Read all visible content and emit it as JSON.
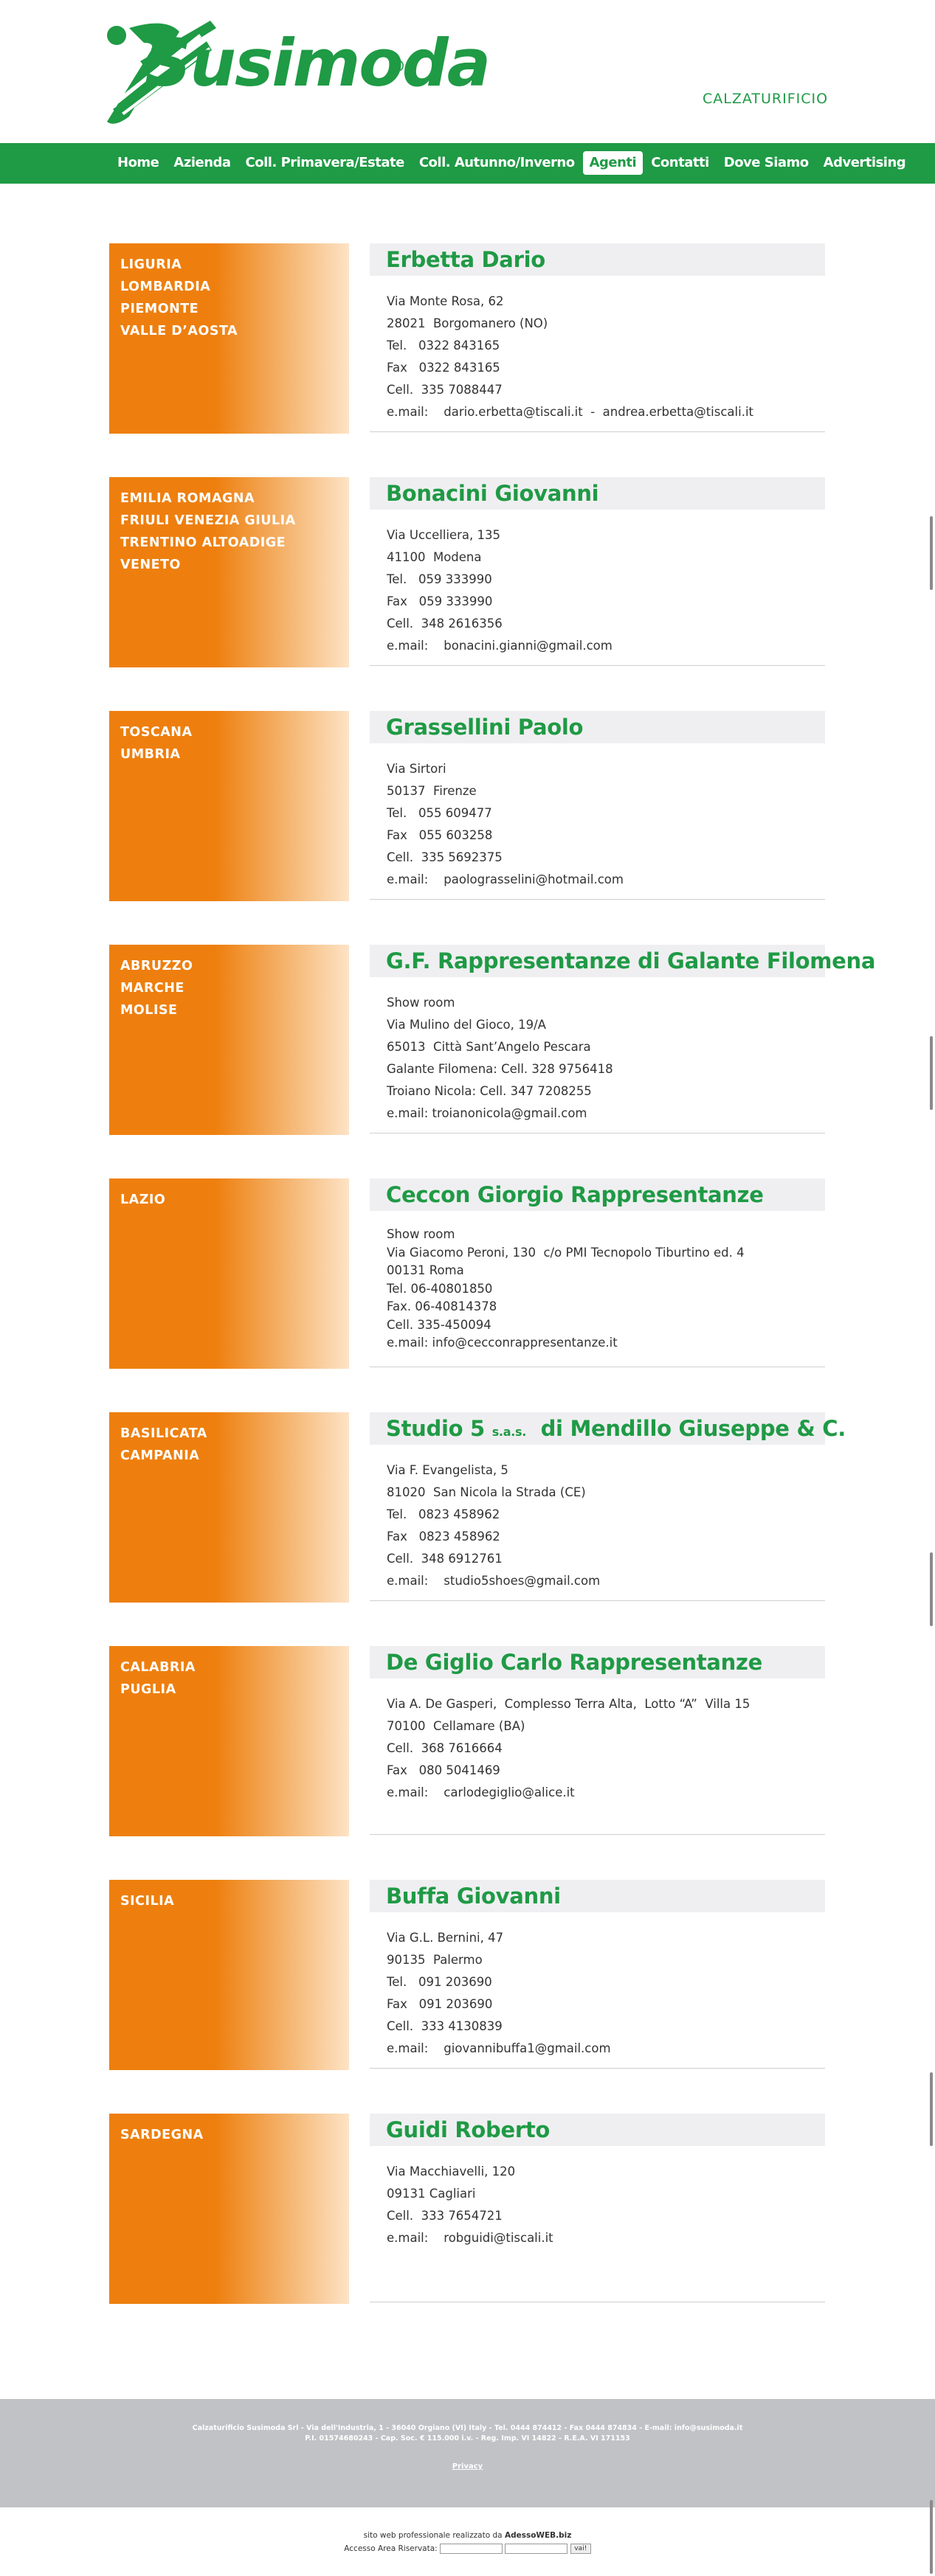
{
  "header": {
    "logo_text": "Susimoda",
    "logo_reg": "®",
    "tagline": "CALZATURIFICIO"
  },
  "nav": {
    "items": [
      {
        "label": "Home",
        "active": false
      },
      {
        "label": "Azienda",
        "active": false
      },
      {
        "label": "Coll. Primavera/Estate",
        "active": false
      },
      {
        "label": "Coll. Autunno/Inverno",
        "active": false
      },
      {
        "label": "Agenti",
        "active": true
      },
      {
        "label": "Contatti",
        "active": false
      },
      {
        "label": "Dove Siamo",
        "active": false
      },
      {
        "label": "Advertising",
        "active": false
      }
    ]
  },
  "agents": [
    {
      "regions": [
        "LIGURIA",
        "LOMBARDIA",
        "PIEMONTE",
        "VALLE D’AOSTA"
      ],
      "name": "Erbetta Dario",
      "lines": [
        "Via Monte Rosa, 62",
        "28021  Borgomanero (NO)",
        "Tel.   0322 843165",
        "Fax   0322 843165",
        "Cell.  335 7088447",
        "e.mail:    dario.erbetta@tiscali.it  -  andrea.erbetta@tiscali.it"
      ]
    },
    {
      "regions": [
        "EMILIA ROMAGNA",
        "FRIULI VENEZIA GIULIA",
        "TRENTINO ALTOADIGE",
        "VENETO"
      ],
      "name": "Bonacini Giovanni",
      "lines": [
        "Via Uccelliera, 135",
        "41100  Modena",
        "Tel.   059 333990",
        "Fax   059 333990",
        "Cell.  348 2616356",
        "e.mail:    bonacini.gianni@gmail.com"
      ]
    },
    {
      "regions": [
        "TOSCANA",
        "UMBRIA"
      ],
      "name": "Grassellini Paolo",
      "lines": [
        "Via Sirtori",
        "50137  Firenze",
        "Tel.   055 609477",
        "Fax   055 603258",
        "Cell.  335 5692375",
        "e.mail:    paolograsselini@hotmail.com"
      ]
    },
    {
      "regions": [
        "ABRUZZO",
        "MARCHE",
        "MOLISE"
      ],
      "name": "G.F. Rappresentanze di Galante Filomena",
      "lines": [
        "Show room",
        "Via Mulino del Gioco, 19/A",
        "65013  Città Sant’Angelo Pescara",
        "Galante Filomena: Cell. 328 9756418",
        "Troiano Nicola: Cell. 347 7208255",
        "e.mail: troianonicola@gmail.com"
      ]
    },
    {
      "regions": [
        "LAZIO"
      ],
      "name": "Ceccon Giorgio Rappresentanze",
      "tight": true,
      "lines": [
        "Show room",
        "Via Giacomo Peroni, 130  c/o PMI Tecnopolo Tiburtino ed. 4",
        "00131 Roma",
        "Tel. 06-40801850",
        "Fax. 06-40814378",
        "Cell. 335-450094",
        "e.mail: info@cecconrappresentanze.it"
      ]
    },
    {
      "regions": [
        "BASILICATA",
        "CAMPANIA"
      ],
      "name_pre": "Studio 5 ",
      "name_small": "s.a.s.",
      "name_post": "  di Mendillo Giuseppe & C.",
      "lines": [
        "Via F. Evangelista, 5",
        "81020  San Nicola la Strada (CE)",
        "Tel.   0823 458962",
        "Fax   0823 458962",
        "Cell.  348 6912761",
        "e.mail:    studio5shoes@gmail.com"
      ]
    },
    {
      "regions": [
        "CALABRIA",
        "PUGLIA"
      ],
      "name": "De Giglio Carlo Rappresentanze",
      "lines": [
        "Via A. De Gasperi,  Complesso Terra Alta,  Lotto “A”  Villa 15",
        "70100  Cellamare (BA)",
        "Cell.  368 7616664",
        "Fax   080 5041469",
        "e.mail:    carlodegiglio@alice.it"
      ]
    },
    {
      "regions": [
        "SICILIA"
      ],
      "name": "Buffa Giovanni",
      "lines": [
        "Via G.L. Bernini, 47",
        "90135  Palermo",
        "Tel.   091 203690",
        "Fax   091 203690",
        "Cell.  333 4130839",
        "e.mail:    giovannibuffa1@gmail.com"
      ]
    },
    {
      "regions": [
        "SARDEGNA"
      ],
      "name": "Guidi Roberto",
      "lines": [
        "Via Macchiavelli, 120",
        "09131 Cagliari",
        "Cell.  333 7654721",
        "e.mail:    robguidi@tiscali.it"
      ]
    }
  ],
  "footer": {
    "line1": "Calzaturificio Susimoda Srl - Via dell'Industria, 1 - 36040 Orgiano (VI) Italy - Tel. 0444 874412 - Fax 0444 874834 - E-mail: info@susimoda.it",
    "line2": "P.I. 01574680243 - Cap. Soc. € 115.000 i.v. - Reg. Imp. VI 14822 - R.E.A. VI 171153",
    "privacy": "Privacy"
  },
  "credits": {
    "prefix": "sito web professionale realizzato da ",
    "brand": "AdessoWEB.biz",
    "access_label": "Accesso Area Riservata: ",
    "go_label": "vai!"
  },
  "colors": {
    "brand_green": "#1f9a45",
    "region_orange": "#ee7f0e",
    "name_bar": "#efeff1",
    "footer_grey": "#c1c2c6"
  }
}
